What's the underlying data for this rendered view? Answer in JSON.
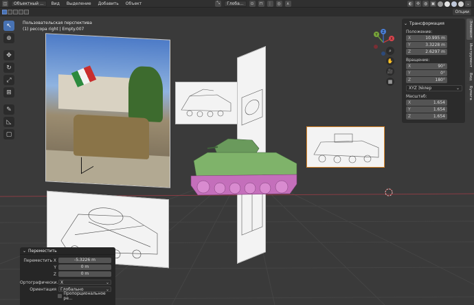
{
  "header": {
    "editor_icon": "3d-viewport-icon",
    "mode": "Объектный ...",
    "menus": [
      "Вид",
      "Выделение",
      "Добавить",
      "Объект"
    ],
    "orientation": "Глоба...",
    "options": "Опции"
  },
  "viewport": {
    "perspective": "Пользовательская перспектива",
    "object_info": "(1) рессора right | Empty.007"
  },
  "gizmo": {
    "x": "X",
    "y": "Y",
    "z": "Z"
  },
  "npanel": {
    "title": "Трансформация",
    "location_label": "Положение:",
    "location": [
      {
        "axis": "X",
        "value": "10.995 m"
      },
      {
        "axis": "Y",
        "value": "3.3228 m"
      },
      {
        "axis": "Z",
        "value": "2.6297 m"
      }
    ],
    "rotation_label": "Вращение:",
    "rotation": [
      {
        "axis": "X",
        "value": "90°"
      },
      {
        "axis": "Y",
        "value": "0°"
      },
      {
        "axis": "Z",
        "value": "180°"
      }
    ],
    "rotation_mode": "XYZ Эйлер",
    "scale_label": "Масштаб:",
    "scale": [
      {
        "axis": "X",
        "value": "1.654"
      },
      {
        "axis": "Y",
        "value": "1.654"
      },
      {
        "axis": "Z",
        "value": "1.654"
      }
    ],
    "tabs": [
      "Элемент",
      "Инструмент",
      "Вид",
      "Бумага"
    ]
  },
  "operator": {
    "title": "Переместить",
    "move_x_label": "Переместить X",
    "move_x": "-5.3226 m",
    "y_label": "Y",
    "move_y": "0 m",
    "z_label": "Z",
    "move_z": "0 m",
    "ortho_label": "Ортографически...",
    "ortho_value": "X",
    "orient_label": "Ориентация",
    "orient_value": "Глобально",
    "proportional": "Пропорциональное ре..."
  }
}
